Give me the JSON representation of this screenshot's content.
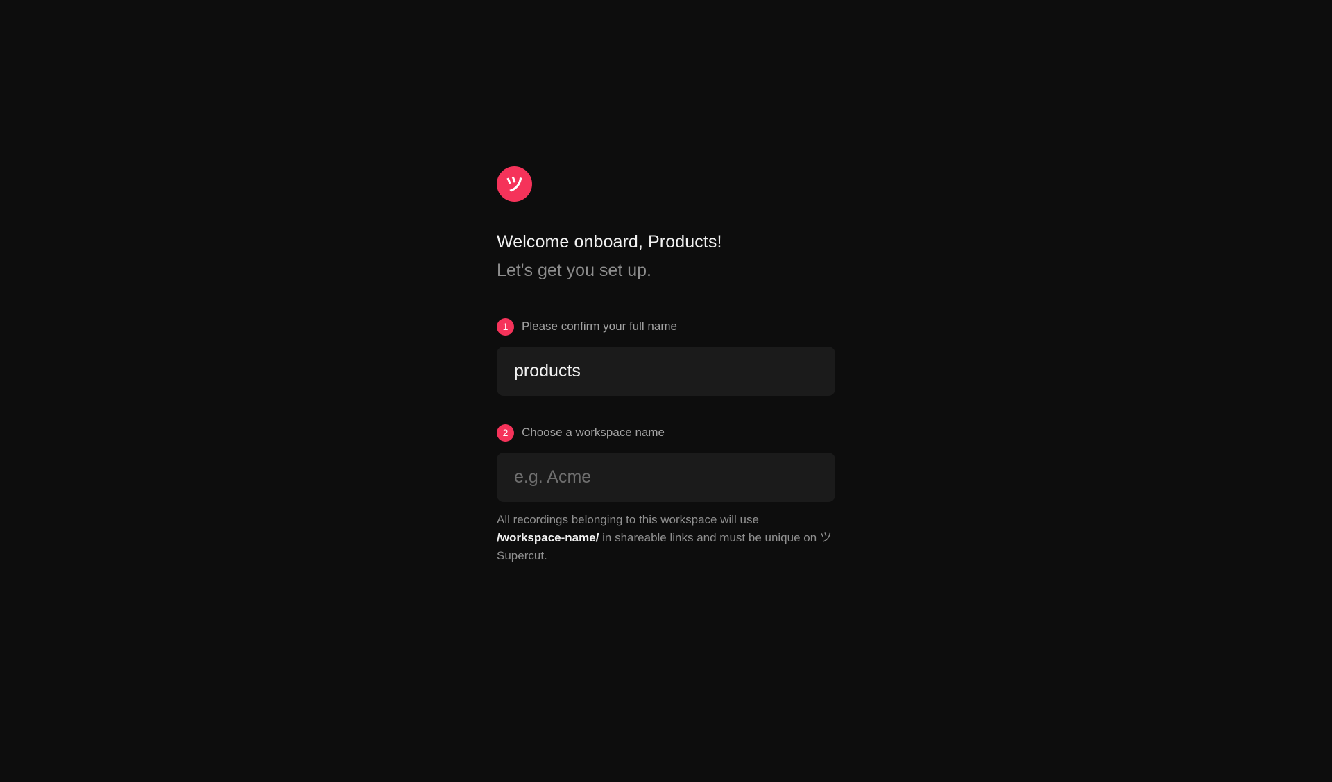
{
  "brand": {
    "logo_glyph": "ツ",
    "accent_color": "#f5335a"
  },
  "header": {
    "title": "Welcome onboard, Products!",
    "subtitle": "Let's get you set up."
  },
  "steps": [
    {
      "number": "1",
      "label": "Please confirm your full name",
      "value": "products",
      "placeholder": ""
    },
    {
      "number": "2",
      "label": "Choose a workspace name",
      "value": "",
      "placeholder": "e.g. Acme"
    }
  ],
  "hint": {
    "prefix": "All recordings belonging to this workspace will use",
    "path": "/workspace-name/",
    "suffix": "in shareable links and must be unique on ツSupercut."
  }
}
